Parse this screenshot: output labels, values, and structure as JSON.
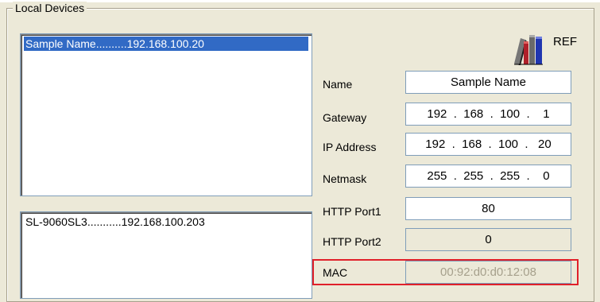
{
  "group": {
    "title": "Local Devices"
  },
  "devices_list": [
    {
      "label": "Sample Name..........192.168.100.20",
      "selected": true
    }
  ],
  "devices_list2": [
    {
      "label": "SL-9060SL3...........192.168.100.203",
      "selected": false
    }
  ],
  "ref": {
    "label": "REF",
    "icon": "books-icon"
  },
  "fields": {
    "name": {
      "label": "Name",
      "value": "Sample Name"
    },
    "gateway": {
      "label": "Gateway",
      "value": "192  .  168  .  100  .    1"
    },
    "ip": {
      "label": "IP Address",
      "value": "192  .  168  .  100  .   20"
    },
    "netmask": {
      "label": "Netmask",
      "value": "255  .  255  .  255  .    0"
    },
    "http1": {
      "label": "HTTP Port1",
      "value": "80"
    },
    "http2": {
      "label": "HTTP Port2",
      "value": "0"
    },
    "mac": {
      "label": "MAC",
      "value": "00:92:d0:d0:12:08"
    }
  },
  "colors": {
    "selection": "#316ac5",
    "highlight": "#e0202a",
    "background": "#ece9d8"
  }
}
